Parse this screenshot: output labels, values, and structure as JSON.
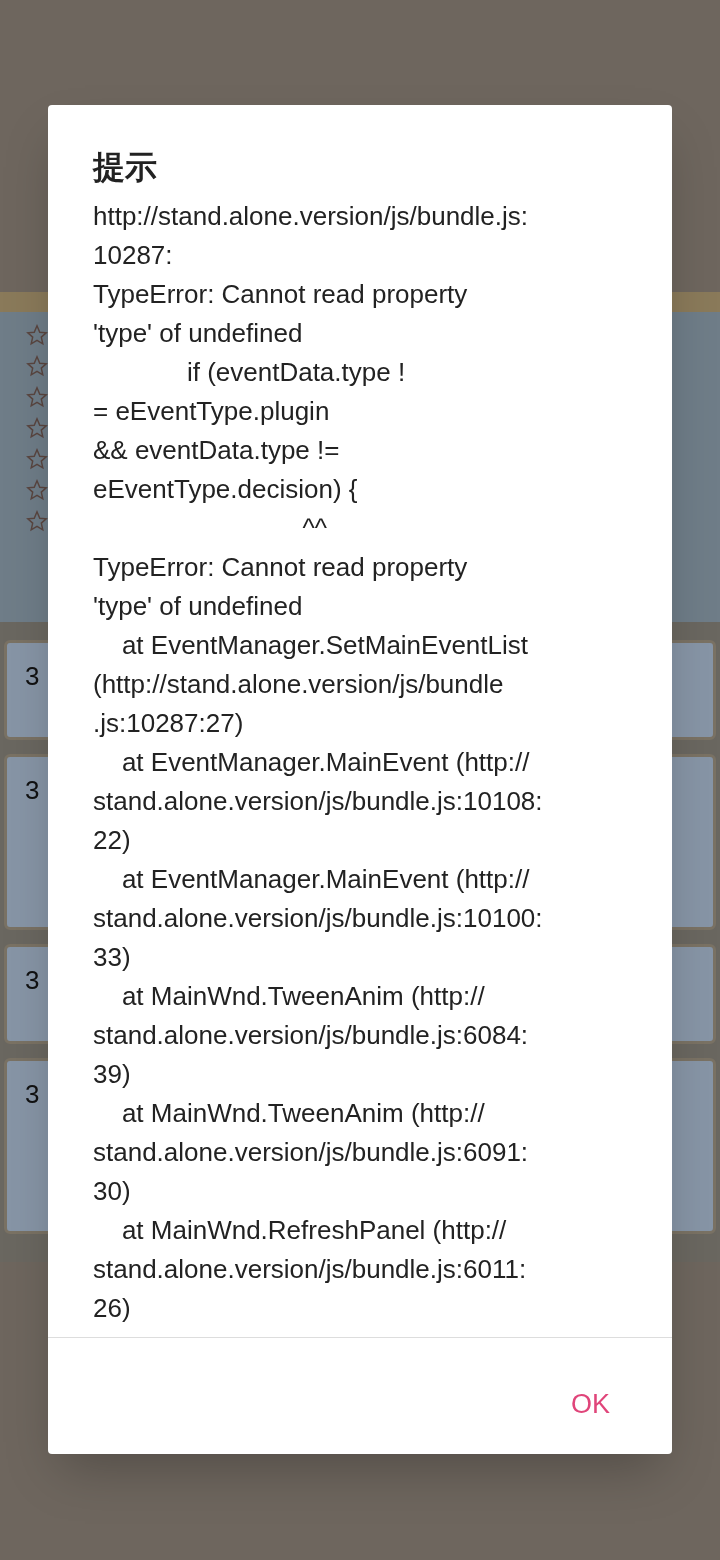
{
  "background": {
    "cards": [
      {
        "label": "3",
        "tall": false
      },
      {
        "label": "3",
        "tall": true
      },
      {
        "label": "3",
        "tall": false
      },
      {
        "label": "3",
        "tall": true
      }
    ]
  },
  "dialog": {
    "title": "提示",
    "message_lines": [
      "http://stand.alone.version/js/bundle.js:",
      "10287:",
      "TypeError: Cannot read property",
      "'type' of undefined",
      "             if (eventData.type !",
      "= eEventType.plugin",
      "&& eventData.type !=",
      "eEventType.decision) {",
      "                             ^^",
      "TypeError: Cannot read property",
      "'type' of undefined",
      "    at EventManager.SetMainEventList",
      "(http://stand.alone.version/js/bundle",
      ".js:10287:27)",
      "    at EventManager.MainEvent (http://",
      "stand.alone.version/js/bundle.js:10108:",
      "22)",
      "    at EventManager.MainEvent (http://",
      "stand.alone.version/js/bundle.js:10100:",
      "33)",
      "    at MainWnd.TweenAnim (http://",
      "stand.alone.version/js/bundle.js:6084:",
      "39)",
      "    at MainWnd.TweenAnim (http://",
      "stand.alone.version/js/bundle.js:6091:",
      "30)",
      "    at MainWnd.RefreshPanel (http://",
      "stand.alone.version/js/bundle.js:6011:",
      "26)"
    ],
    "buttons": [
      "OK"
    ]
  }
}
